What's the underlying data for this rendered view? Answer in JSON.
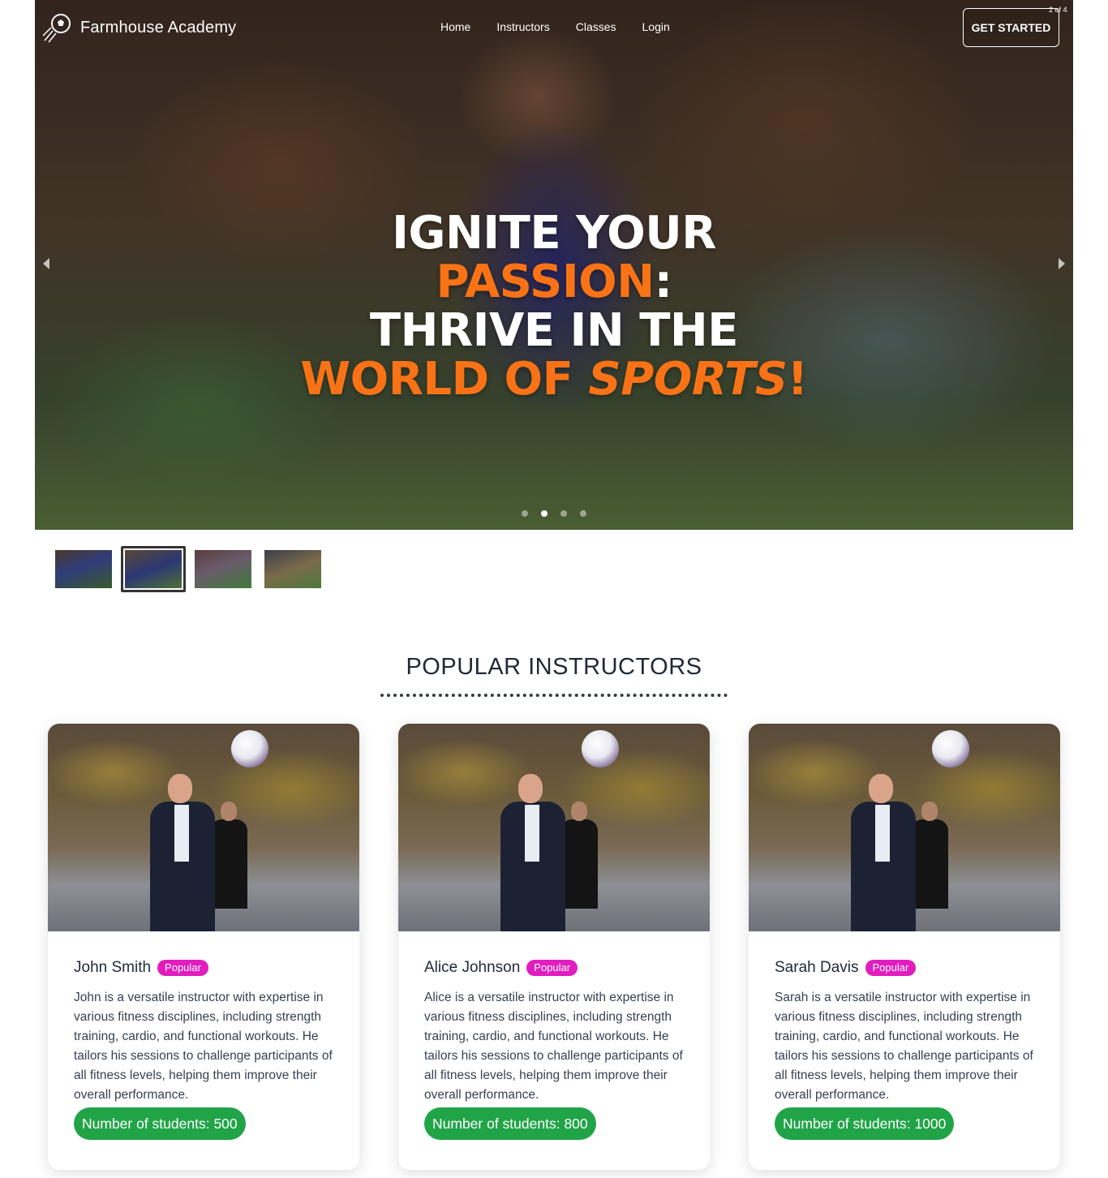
{
  "brand": {
    "name": "Farmhouse Academy",
    "logo_icon": "soccer-ball-icon"
  },
  "nav": {
    "items": [
      "Home",
      "Instructors",
      "Classes",
      "Login"
    ]
  },
  "hero": {
    "cta_label": "GET STARTED",
    "counter": "2 of 4",
    "headline": {
      "line1": "IGNITE YOUR",
      "line2_highlight": "PASSION",
      "line2_rest": ":",
      "line3": "THRIVE IN THE",
      "line4_highlight": "WORLD OF",
      "line4_italic": "SPORTS",
      "line4_end": "!"
    },
    "accent_color": "#f97316",
    "slides_total": 4,
    "active_slide": 2
  },
  "section": {
    "title": "POPULAR INSTRUCTORS"
  },
  "instructors": [
    {
      "name": "John Smith",
      "badge": "Popular",
      "description": "John is a versatile instructor with expertise in various fitness disciplines, including strength training, cardio, and functional workouts. He tailors his sessions to challenge participants of all fitness levels, helping them improve their overall performance.",
      "students": "Number of students: 500"
    },
    {
      "name": "Alice Johnson",
      "badge": "Popular",
      "description": "Alice is a versatile instructor with expertise in various fitness disciplines, including strength training, cardio, and functional workouts. He tailors his sessions to challenge participants of all fitness levels, helping them improve their overall performance.",
      "students": "Number of students: 800"
    },
    {
      "name": "Sarah Davis",
      "badge": "Popular",
      "description": "Sarah is a versatile instructor with expertise in various fitness disciplines, including strength training, cardio, and functional workouts. He tailors his sessions to challenge participants of all fitness levels, helping them improve their overall performance.",
      "students": "Number of students: 1000"
    }
  ],
  "colors": {
    "badge": "#e11dbf",
    "students_pill": "#21a448",
    "accent": "#f97316"
  }
}
